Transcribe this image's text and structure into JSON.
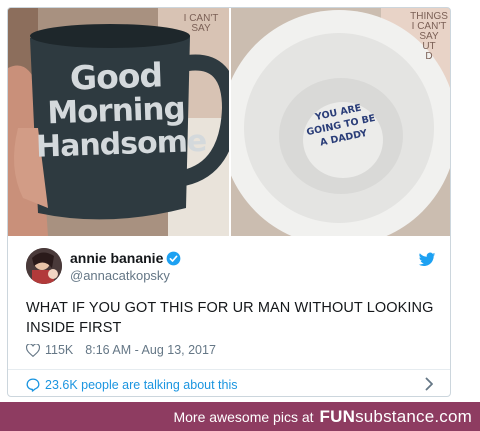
{
  "media": {
    "left_photo": {
      "mug_lines": [
        "Good",
        "Morning",
        "Handsome"
      ],
      "shelf_text": [
        "I CAN'T",
        "SAY"
      ]
    },
    "right_photo": {
      "inside_lines": [
        "YOU ARE",
        "GOING TO BE",
        "A DADDY"
      ],
      "shelf_text": [
        "THINGS",
        "I CAN'T",
        "SAY",
        "UT",
        "D"
      ]
    }
  },
  "tweet": {
    "display_name": "annie bananie",
    "handle": "@annacatkopsky",
    "text": "WHAT IF YOU GOT THIS FOR UR MAN WITHOUT LOOKING INSIDE FIRST",
    "likes": "115K",
    "timestamp": "8:16 AM - Aug 13, 2017",
    "talking": "23.6K people are talking about this"
  },
  "footer": {
    "text": "More awesome pics at",
    "brand_bold": "FUN",
    "brand_rest": "substance.com"
  },
  "colors": {
    "twitter_blue": "#1da1f2",
    "link_blue": "#1b95e0",
    "footer_bg": "#8e3c61"
  },
  "icons": [
    "verified-badge-icon",
    "twitter-bird-icon",
    "heart-icon",
    "speech-bubble-icon",
    "chevron-right-icon"
  ]
}
